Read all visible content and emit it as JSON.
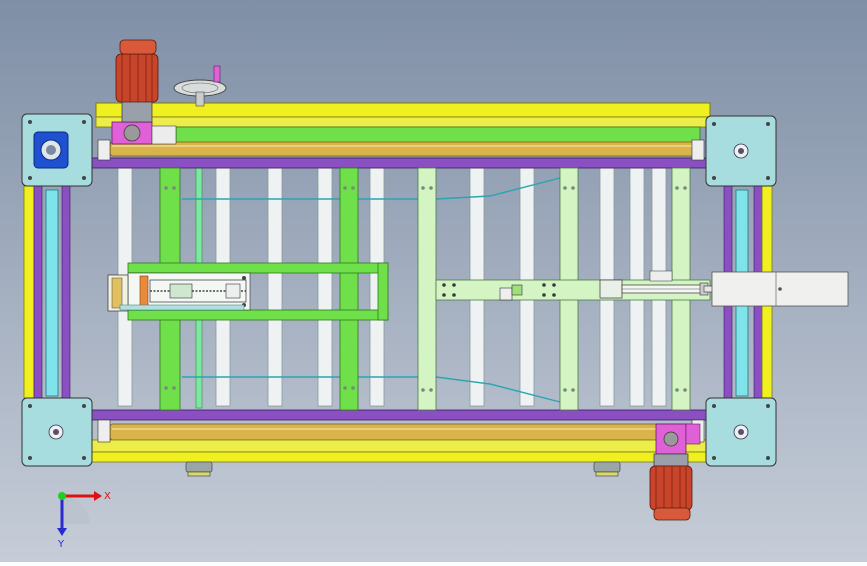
{
  "viewport": {
    "background_top": "#7f8fa6",
    "background_bottom": "#c6cdd8"
  },
  "triad": {
    "x_label": "X",
    "y_label": "Y",
    "x_color": "#e01010",
    "y_color": "#2a2ad0",
    "origin_color": "#22cc22"
  },
  "colors": {
    "frame_yellow": "#f0f020",
    "frame_purple": "#8a4fc0",
    "green_member": "#6fe04a",
    "light_green": "#d4f4c4",
    "cyan_shaft": "#7fe3ea",
    "roller_white": "#eef2f2",
    "corner_block": "#a8dde0",
    "motor_red": "#c8442a",
    "magenta_gear": "#e060d8",
    "tan_roller": "#d9b44a",
    "blue_flange": "#1e50d0"
  },
  "icons": {
    "motor_top": "motor-icon",
    "motor_bottom": "motor-icon",
    "handwheel": "handwheel-icon",
    "triad": "axis-triad-icon"
  }
}
